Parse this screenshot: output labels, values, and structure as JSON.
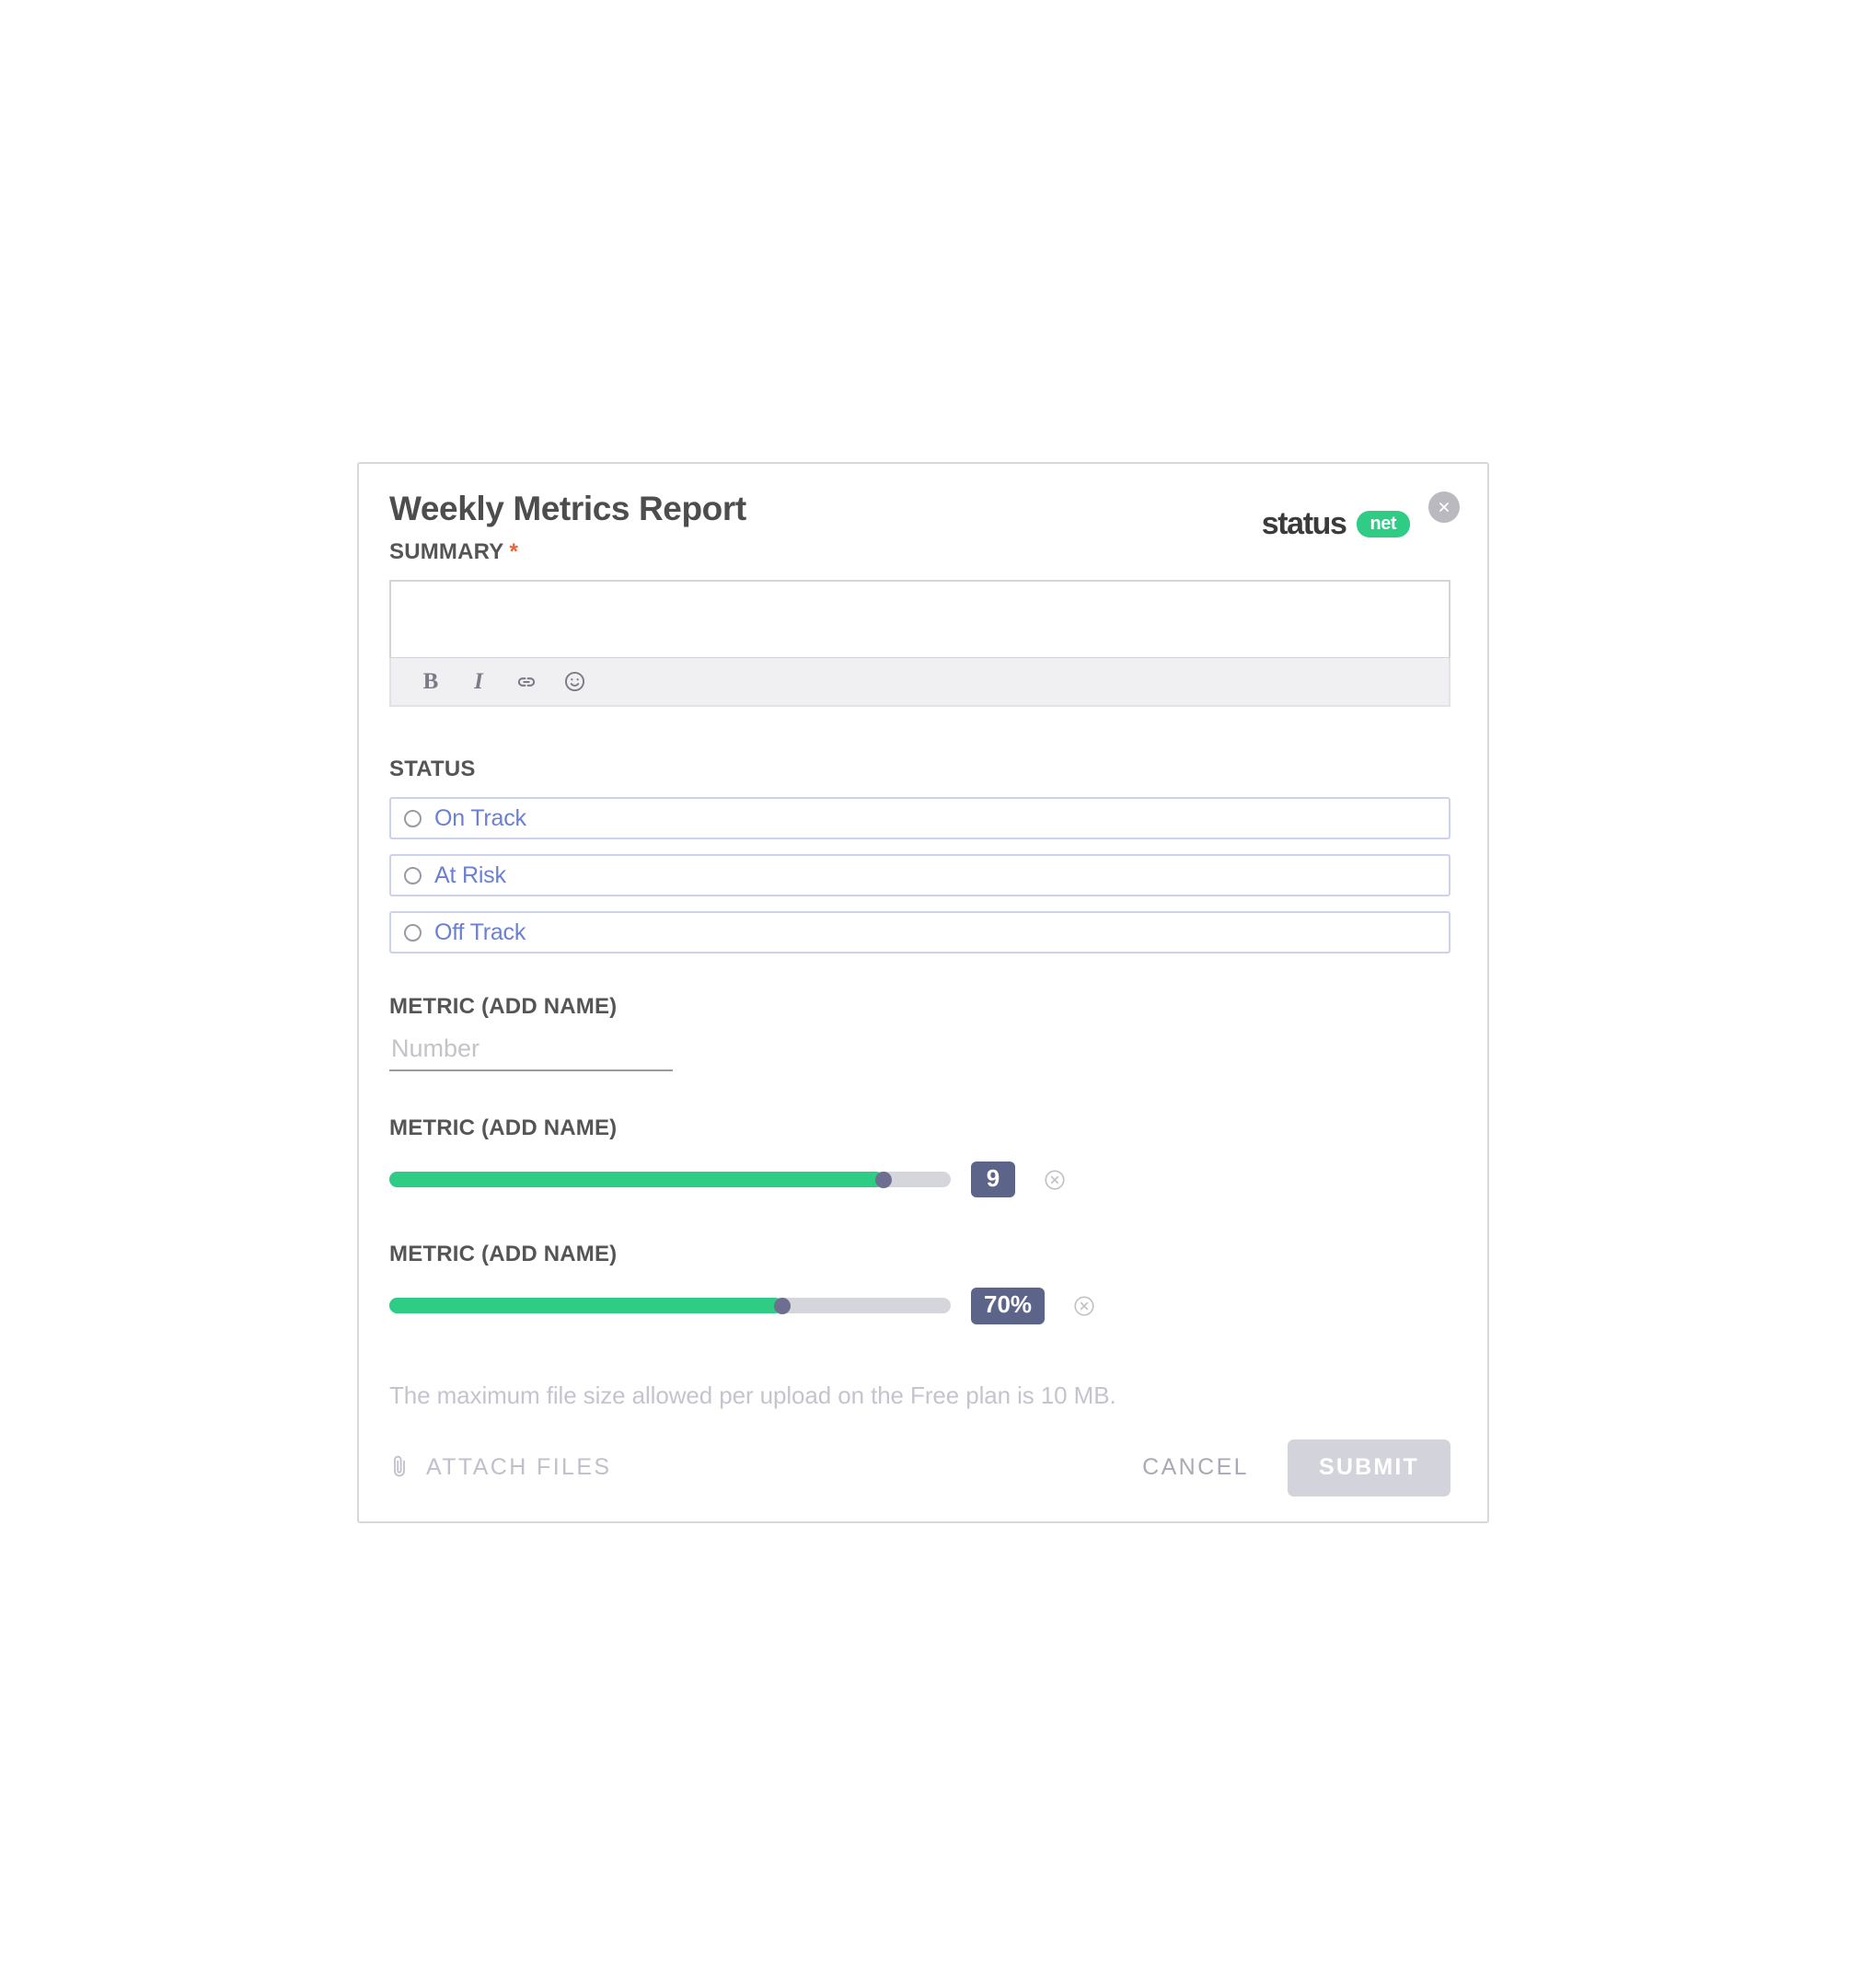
{
  "modal": {
    "title": "Weekly Metrics Report",
    "close_icon": "close-icon",
    "brand": {
      "word": "status",
      "pill": "net"
    }
  },
  "summary": {
    "label": "SUMMARY",
    "required_marker": "*",
    "value": "",
    "placeholder": "",
    "toolbar": [
      {
        "icon": "bold-icon",
        "glyph": "B"
      },
      {
        "icon": "italic-icon",
        "glyph": "I"
      },
      {
        "icon": "link-icon",
        "glyph": ""
      },
      {
        "icon": "emoji-icon",
        "glyph": ""
      }
    ]
  },
  "status": {
    "label": "STATUS",
    "options": [
      {
        "label": "On Track",
        "selected": false
      },
      {
        "label": "At Risk",
        "selected": false
      },
      {
        "label": "Off Track",
        "selected": false
      }
    ]
  },
  "metrics": [
    {
      "label": "METRIC (ADD NAME)",
      "type": "number",
      "value": "",
      "placeholder": "Number"
    },
    {
      "label": "METRIC (ADD NAME)",
      "type": "slider",
      "value": "9",
      "percent": 88,
      "remove_icon": "remove-circle-icon"
    },
    {
      "label": "METRIC (ADD NAME)",
      "type": "slider",
      "value": "70%",
      "percent": 70,
      "remove_icon": "remove-circle-icon"
    }
  ],
  "footer": {
    "file_note": "The maximum file size allowed per upload on the Free plan is 10 MB.",
    "attach_label": "ATTACH FILES",
    "attach_icon": "paperclip-icon",
    "cancel_label": "CANCEL",
    "submit_label": "SUBMIT"
  },
  "colors": {
    "brand_green": "#2ecc84",
    "required_orange": "#e8633a",
    "option_blue": "#6b7fd3",
    "badge_slate": "#5d6489",
    "disabled_gray": "#d3d3dc"
  }
}
